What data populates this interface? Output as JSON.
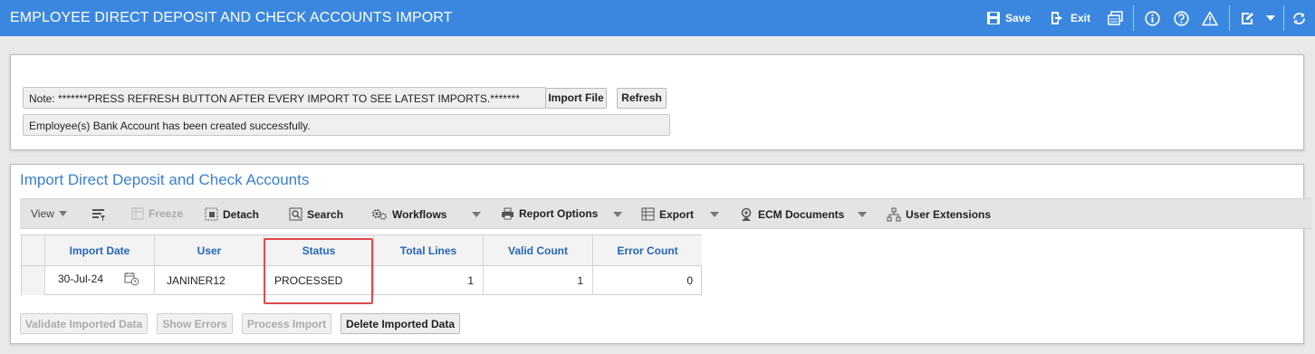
{
  "window": {
    "title": "EMPLOYEE DIRECT DEPOSIT AND CHECK ACCOUNTS IMPORT",
    "save_label": "Save",
    "exit_label": "Exit",
    "accent_color": "#3b87df",
    "icons": [
      "save-icon",
      "exit-icon",
      "copy-window-icon",
      "info-icon",
      "help-icon",
      "warning-icon",
      "edit-icon",
      "chevron-down-icon",
      "refresh-icon"
    ]
  },
  "top_panel": {
    "note": "Note: *******PRESS REFRESH BUTTON AFTER EVERY IMPORT TO SEE LATEST IMPORTS.*******",
    "import_file_label": "Import File",
    "refresh_label": "Refresh",
    "message": "Employee(s) Bank Account has been created successfully."
  },
  "section": {
    "title": "Import Direct Deposit and Check Accounts"
  },
  "toolbar": {
    "view_label": "View",
    "freeze_label": "Freeze",
    "detach_label": "Detach",
    "search_label": "Search",
    "workflows_label": "Workflows",
    "report_options_label": "Report Options",
    "export_label": "Export",
    "ecm_documents_label": "ECM Documents",
    "user_extensions_label": "User Extensions"
  },
  "table": {
    "columns": [
      "Import Date",
      "User",
      "Status",
      "Total Lines",
      "Valid Count",
      "Error Count"
    ],
    "rows": [
      {
        "import_date": "30-Jul-24",
        "user": "JANINER12",
        "status": "PROCESSED",
        "total_lines": "1",
        "valid_count": "1",
        "error_count": "0"
      }
    ],
    "header_color": "#2566b8",
    "highlight_color": "#e0484c"
  },
  "actions": {
    "validate_label": "Validate Imported Data",
    "show_errors_label": "Show Errors",
    "process_label": "Process Import",
    "delete_label": "Delete Imported Data"
  }
}
